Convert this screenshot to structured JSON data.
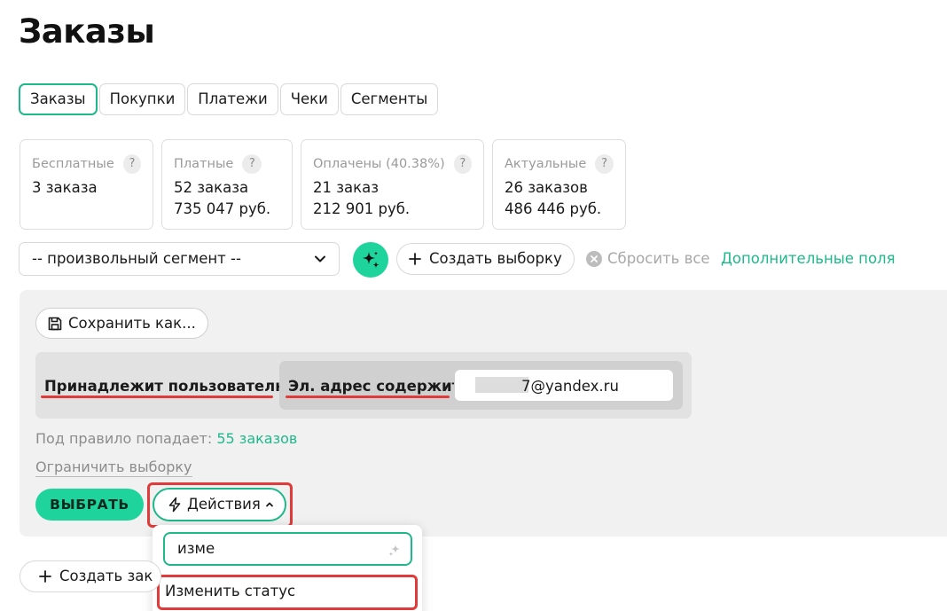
{
  "page": {
    "title": "Заказы"
  },
  "tabs": [
    {
      "label": "Заказы",
      "active": true
    },
    {
      "label": "Покупки",
      "active": false
    },
    {
      "label": "Платежи",
      "active": false
    },
    {
      "label": "Чеки",
      "active": false
    },
    {
      "label": "Сегменты",
      "active": false
    }
  ],
  "stats": [
    {
      "label": "Бесплатные",
      "count": "3 заказа",
      "sum": ""
    },
    {
      "label": "Платные",
      "count": "52 заказа",
      "sum": "735 047 руб."
    },
    {
      "label": "Оплачены (40.38%)",
      "count": "21 заказ",
      "sum": "212 901 руб."
    },
    {
      "label": "Актуальные",
      "count": "26 заказов",
      "sum": "486 446 руб."
    }
  ],
  "help_glyph": "?",
  "filters": {
    "segment_value": "-- произвольный сегмент --",
    "create_selection_label": "Создать выборку",
    "reset_all_label": "Сбросить все",
    "extra_fields_label": "Дополнительные поля"
  },
  "segment_panel": {
    "save_as_label": "Сохранить как...",
    "rule_condition_1": "Принадлежит пользователю",
    "rule_condition_2": "Эл. адрес содержит",
    "email_value": "7@yandex.ru",
    "match_label": "Под правило попадает:",
    "match_count": "55 заказов",
    "limit_label": "Ограничить выборку",
    "select_label": "ВЫБРАТЬ",
    "actions_label": "Действия"
  },
  "actions_dropdown": {
    "search_value": "изме",
    "items": [
      "Изменить статус"
    ]
  },
  "bottom": {
    "create_label": "Создать зак"
  },
  "colors": {
    "accent": "#1ed49c",
    "accent_text": "#1fb88a",
    "highlight": "#e03a3a",
    "panel_bg": "#f1f1f1"
  },
  "icons": {
    "segment_chevron": "chevron-down-icon",
    "ai": "sparkle-icon",
    "create": "plus-icon",
    "reset": "close-circle-icon",
    "save": "floppy-disk-icon",
    "actions": "lightning-icon",
    "actions_caret": "chevron-up-icon",
    "search_ai": "sparkle-icon"
  }
}
